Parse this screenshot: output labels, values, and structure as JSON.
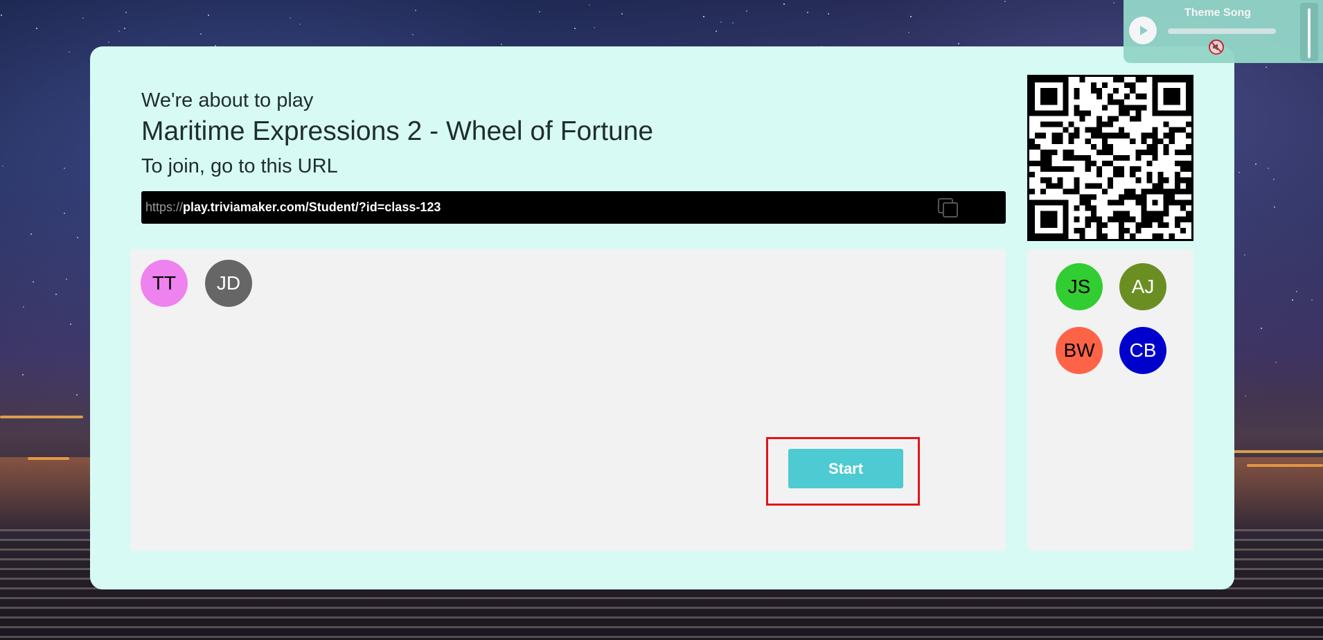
{
  "intro": {
    "about": "We're about to play",
    "game_title": "Maritime Expressions 2 - Wheel of Fortune",
    "join_text": "To join, go to this URL"
  },
  "url": {
    "scheme": "https://",
    "rest": "play.triviamaker.com/Student/?id=class-123"
  },
  "lobby_players": [
    {
      "initials": "TT",
      "color": "#ee82ee",
      "text_color": "#000000"
    },
    {
      "initials": "JD",
      "color": "#666666",
      "text_color": "#ffffff"
    }
  ],
  "team_players": [
    {
      "initials": "JS",
      "color": "#32cd32",
      "text_color": "#000000"
    },
    {
      "initials": "AJ",
      "color": "#6b8e23",
      "text_color": "#ffffff"
    },
    {
      "initials": "BW",
      "color": "#ff6347",
      "text_color": "#000000"
    },
    {
      "initials": "CB",
      "color": "#0000cd",
      "text_color": "#ffffff"
    }
  ],
  "start_label": "Start",
  "player": {
    "title": "Theme Song",
    "icons": {
      "play": "play-icon",
      "mute": "mute-icon",
      "copy": "copy-icon"
    }
  },
  "colors": {
    "card": "#d7faf5",
    "start_button": "#4ecad2",
    "highlight": "#e0141b"
  }
}
